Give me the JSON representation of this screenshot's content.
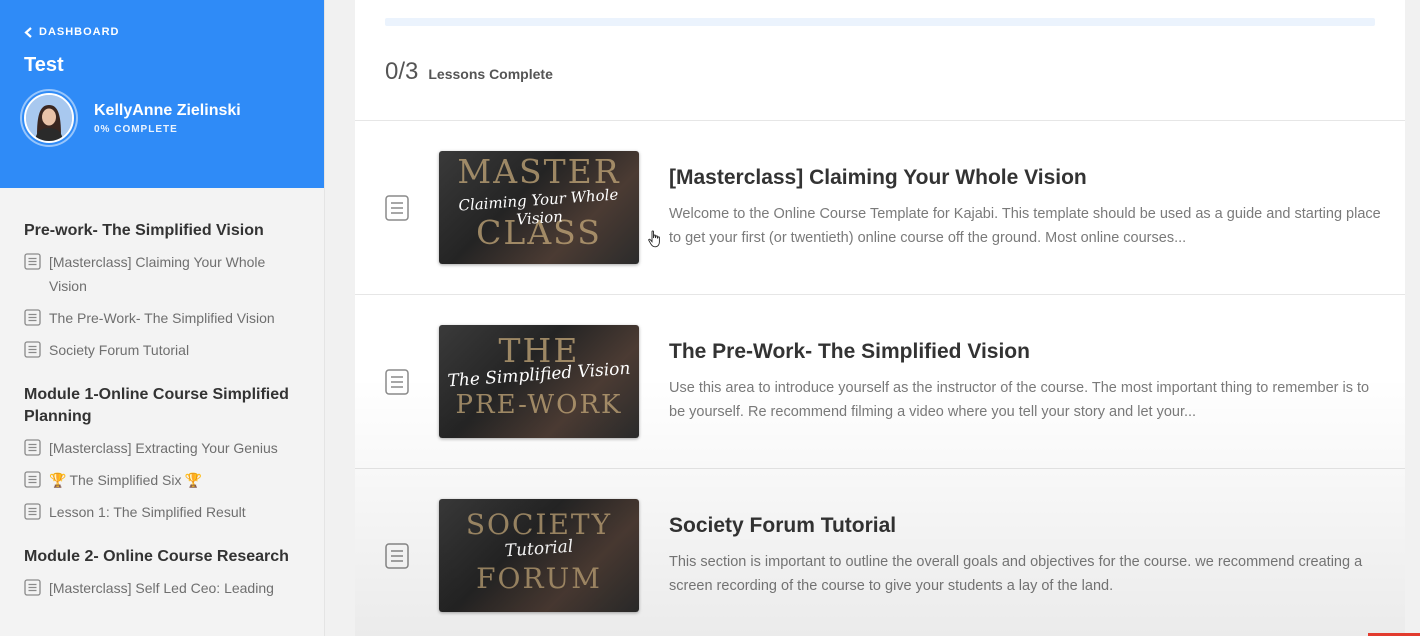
{
  "sidebar": {
    "back_label": "DASHBOARD",
    "course_title": "Test",
    "user_name": "KellyAnne Zielinski",
    "user_progress": "0% COMPLETE",
    "modules": [
      {
        "title": "Pre-work- The Simplified Vision",
        "lessons": [
          "[Masterclass] Claiming Your Whole Vision",
          "The Pre-Work- The Simplified Vision",
          "Society Forum Tutorial"
        ]
      },
      {
        "title": "Module 1-Online Course Simplified Planning",
        "lessons": [
          "[Masterclass] Extracting Your Genius",
          "The Simplified Six",
          "Lesson 1: The Simplified Result"
        ]
      },
      {
        "title": "Module 2- Online Course Research",
        "lessons": [
          "[Masterclass] Self Led Ceo: Leading"
        ]
      }
    ]
  },
  "main": {
    "progress_fraction": 0,
    "completed": "0/3",
    "completed_label": "Lessons Complete",
    "lessons": [
      {
        "title": "[Masterclass] Claiming Your Whole Vision",
        "description": "Welcome to the Online Course Template for Kajabi. This template should be used as a guide and starting place to get your first (or twentieth) online course off the ground. Most online courses...",
        "thumb_big_top": "MASTER",
        "thumb_big_bottom": "CLASS",
        "thumb_script": "Claiming Your Whole Vision"
      },
      {
        "title": "The Pre-Work- The Simplified Vision",
        "description": "Use this area to introduce yourself as the instructor of the course. The most important thing to remember is to be yourself. Re recommend filming a video where you tell your story and let your...",
        "thumb_big_top": "THE",
        "thumb_big_bottom": "PRE-WORK",
        "thumb_script": "The Simplified Vision"
      },
      {
        "title": "Society Forum Tutorial",
        "description": "This section is important to outline the overall goals and objectives for the course. we recommend creating a screen recording of the course to give your students a lay of the land.",
        "thumb_big_top": "SOCIETY",
        "thumb_big_bottom": "FORUM",
        "thumb_script": "Tutorial"
      }
    ]
  },
  "colors": {
    "accent": "#2f8bf7",
    "trophy": "#d6a21b"
  },
  "icons": {
    "back": "chevron-left-icon",
    "lesson": "document-icon",
    "trophy": "trophy-icon",
    "cursor": "hand-pointer-icon"
  }
}
